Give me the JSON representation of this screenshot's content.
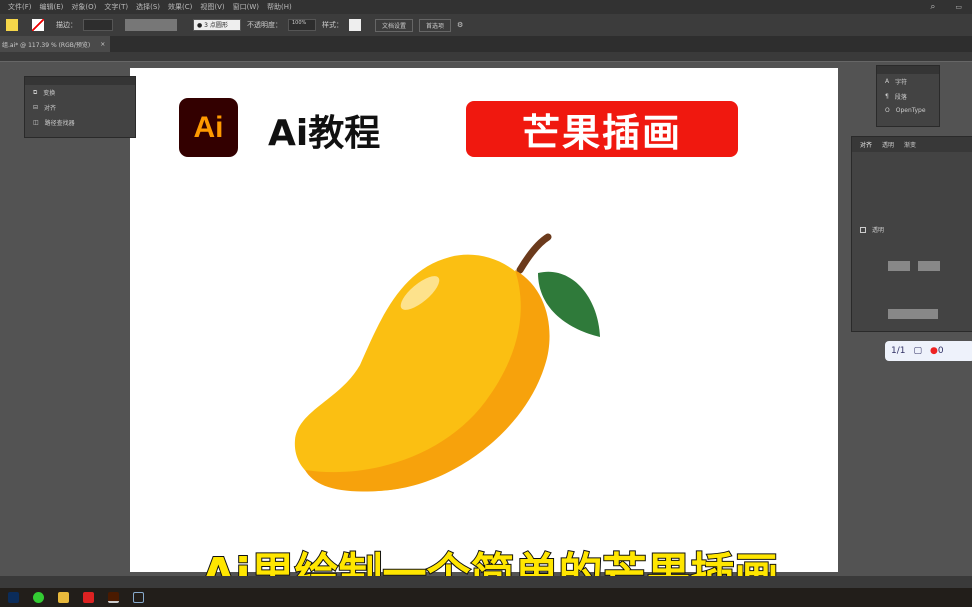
{
  "menu": [
    "文件(F)",
    "编辑(E)",
    "对象(O)",
    "文字(T)",
    "选择(S)",
    "效果(C)",
    "视图(V)",
    "窗口(W)",
    "帮助(H)"
  ],
  "toolbar": {
    "stroke_label": "描边：",
    "brush": "● 3 点圆形",
    "opacity_label": "不透明度：",
    "opacity": "100%",
    "style_label": "样式：",
    "doc_setup": "文档设置",
    "prefs": "首选项",
    "fill_color": "#f5d64a"
  },
  "doc_tab": {
    "name": "组.ai* @ 117.39 % (RGB/预览)",
    "close": "×"
  },
  "left_panel": {
    "items": [
      "变换",
      "对齐",
      "路径查找器"
    ]
  },
  "right_panel_top": {
    "items": [
      "字符",
      "段落",
      "OpenType"
    ]
  },
  "right_panel": {
    "tabs": [
      "对齐",
      "透明",
      "渐变"
    ],
    "section": "透明"
  },
  "artboard": {
    "logo_text": "Ai",
    "title": "Ai教程",
    "badge": "芒果插画",
    "badge_color": "#f0180f"
  },
  "counter": {
    "pages": "1/1",
    "dots": "0"
  },
  "subtitle": "Ai里绘制一个简单的芒果插画",
  "mango_colors": {
    "body": "#fbbf12",
    "shade": "#f7a20c",
    "leaf": "#2f7a3a",
    "stem": "#6b3a1c"
  }
}
